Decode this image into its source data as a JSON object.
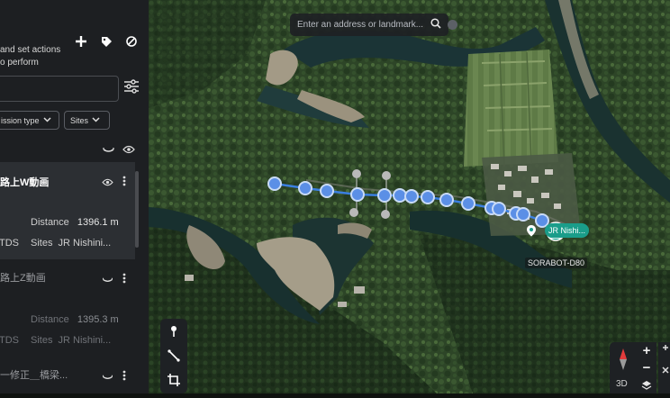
{
  "panel": {
    "hint_line1": "and set actions",
    "hint_line2": "o perform",
    "add_icon": "plus-icon",
    "tag_icon": "tag-icon",
    "hide_icon": "prohibited-icon",
    "filter_icon": "sliders-icon",
    "filter_mission_type": "ission type",
    "filter_sites": "Sites",
    "items": [
      {
        "title": "路上W動画",
        "distance_label": "Distance",
        "distance_value": "1396.1 m",
        "left_code": "TDS",
        "site_label": "Sites",
        "site_value": "JR Nishini...",
        "selected": true
      },
      {
        "title": "路上Z動画",
        "distance_label": "Distance",
        "distance_value": "1395.3 m",
        "left_code": "TDS",
        "site_label": "Sites",
        "site_value": "JR Nishini...",
        "selected": false
      },
      {
        "title": "一修正＿橋梁...",
        "selected": false
      }
    ]
  },
  "map": {
    "search_placeholder": "Enter an address or landmark...",
    "site_label": "JR Nishi...",
    "drone_label": "SORABOT-D80",
    "view_3d": "3D",
    "zoom_in": "+",
    "zoom_out": "−",
    "tools": [
      "pin-tool-icon",
      "line-tool-icon",
      "crop-tool-icon"
    ],
    "route_color": "#3b7fe0",
    "site_color": "#1a9d8a"
  }
}
